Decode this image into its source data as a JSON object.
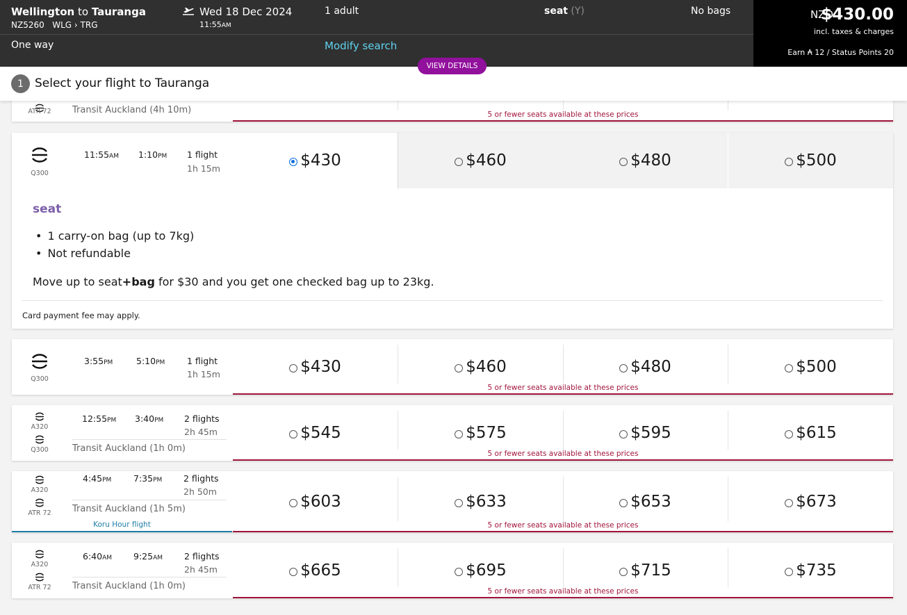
{
  "header": {
    "origin": "Wellington",
    "to_word": "to",
    "destination": "Tauranga",
    "flight_no": "NZ5260",
    "origin_code": "WLG",
    "dest_code": "TRG",
    "date": "Wed 18 Dec 2024",
    "time": "11:55",
    "time_suffix": "AM",
    "passengers": "1 adult",
    "fare_name": "seat",
    "fare_class": "(Y)",
    "bags": "No bags",
    "trip_type": "One way",
    "modify_label": "Modify search",
    "view_details_label": "VIEW DETAILS"
  },
  "total": {
    "currency": "NZD",
    "amount": "$430.00",
    "incl": "incl. taxes & charges",
    "earn": "Earn ₳ 12 / Status Points 20"
  },
  "step": {
    "number": "1",
    "title": "Select your flight to Tauranga"
  },
  "seats_notice": "5 or fewer seats available at these prices",
  "flights": [
    {
      "aircraft": [
        "ATR 72"
      ],
      "transit": "Transit Auckland (4h 10m)",
      "prices": [
        "",
        "",
        "",
        ""
      ]
    },
    {
      "aircraft": [
        "Q300"
      ],
      "dep": "11:55",
      "dep_s": "AM",
      "arr": "1:10",
      "arr_s": "PM",
      "flights": "1 flight",
      "duration": "1h 15m",
      "prices": [
        "$430",
        "$460",
        "$480",
        "$500"
      ],
      "selected": 0,
      "details": {
        "fare": "seat",
        "features": [
          "1 carry-on bag (up to 7kg)",
          "Not refundable"
        ],
        "upsell_pre": "Move up to seat",
        "upsell_bold": "+bag",
        "upsell_post": " for $30 and you get one checked bag up to 23kg.",
        "fee": "Card payment fee may apply."
      }
    },
    {
      "aircraft": [
        "Q300"
      ],
      "dep": "3:55",
      "dep_s": "PM",
      "arr": "5:10",
      "arr_s": "PM",
      "flights": "1 flight",
      "duration": "1h 15m",
      "prices": [
        "$430",
        "$460",
        "$480",
        "$500"
      ]
    },
    {
      "aircraft": [
        "A320",
        "Q300"
      ],
      "dep": "12:55",
      "dep_s": "PM",
      "arr": "3:40",
      "arr_s": "PM",
      "flights": "2 flights",
      "duration": "2h 45m",
      "transit": "Transit Auckland (1h 0m)",
      "prices": [
        "$545",
        "$575",
        "$595",
        "$615"
      ]
    },
    {
      "aircraft": [
        "A320",
        "ATR 72"
      ],
      "dep": "4:45",
      "dep_s": "PM",
      "arr": "7:35",
      "arr_s": "PM",
      "flights": "2 flights",
      "duration": "2h 50m",
      "transit": "Transit Auckland (1h 5m)",
      "koru": "Koru Hour flight",
      "prices": [
        "$603",
        "$633",
        "$653",
        "$673"
      ]
    },
    {
      "aircraft": [
        "A320",
        "ATR 72"
      ],
      "dep": "6:40",
      "dep_s": "AM",
      "arr": "9:25",
      "arr_s": "AM",
      "flights": "2 flights",
      "duration": "2h 45m",
      "transit": "Transit Auckland (1h 0m)",
      "prices": [
        "$665",
        "$695",
        "$715",
        "$735"
      ]
    }
  ]
}
